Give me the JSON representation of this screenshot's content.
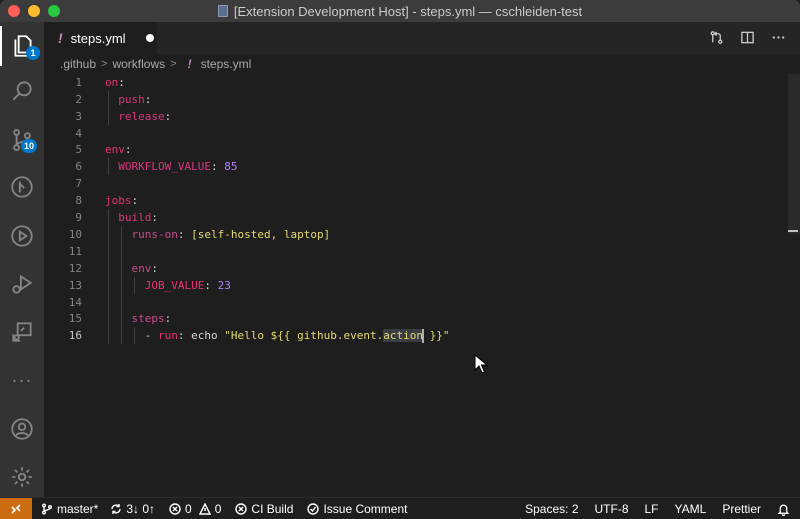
{
  "window": {
    "title": "[Extension Development Host] - steps.yml — cschleiden-test"
  },
  "activity_bar": {
    "explorer_badge": "1",
    "scm_badge": "10",
    "more": "···"
  },
  "tab": {
    "label": "steps.yml",
    "bang": "!"
  },
  "breadcrumb": {
    "seg1": ".github",
    "seg2": "workflows",
    "bang": "!",
    "file": "steps.yml",
    "sep": ">"
  },
  "editor": {
    "line_numbers": [
      "1",
      "2",
      "3",
      "4",
      "5",
      "6",
      "7",
      "8",
      "9",
      "10",
      "11",
      "12",
      "13",
      "14",
      "15",
      "16"
    ],
    "l1_key": "on",
    "colon": ":",
    "l2_key": "push",
    "l3_key": "release",
    "l5_key": "env",
    "l6_key": "WORKFLOW_VALUE",
    "l6_val": "85",
    "l8_key": "jobs",
    "l9_key": "build",
    "l10_key": "runs-on",
    "l10_val": "[self-hosted, laptop]",
    "l12_key": "env",
    "l13_key": "JOB_VALUE",
    "l13_val": "23",
    "l15_key": "steps",
    "l16_dash": "- ",
    "l16_key": "run",
    "l16_val_a": "echo",
    "l16_val_b": "\"Hello ${{ github.event.",
    "l16_sel": "action",
    "l16_val_c": " }}\""
  },
  "statusbar": {
    "branch": "master*",
    "sync": "3↓ 0↑",
    "problems": "0",
    "warnings": "0",
    "ci_build": "CI Build",
    "issue_comment": "Issue Comment",
    "spaces": "Spaces: 2",
    "encoding": "UTF-8",
    "eol": "LF",
    "language": "YAML",
    "formatter": "Prettier"
  },
  "colors": {
    "accent": "#007acc",
    "remote": "#cc6d12",
    "key": "#e8336e",
    "string": "#e6db74",
    "number": "#ae81ff"
  }
}
